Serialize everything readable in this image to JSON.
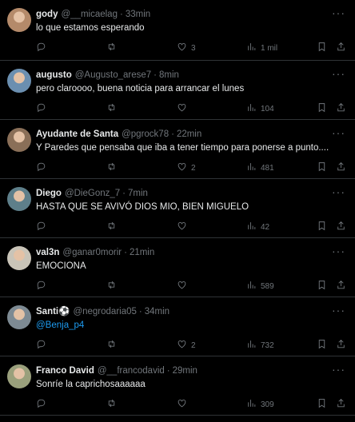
{
  "tweets": [
    {
      "name": "gody",
      "handle": "@__micaelag",
      "sep": "·",
      "time": "33min",
      "text": "lo que estamos esperando",
      "likes": "3",
      "views": "1 mil",
      "avatar": "#b48a6a"
    },
    {
      "name": "augusto",
      "handle": "@Augusto_arese7",
      "sep": "·",
      "time": "8min",
      "text": "pero claroooo, buena noticia para arrancar el lunes",
      "likes": "",
      "views": "104",
      "avatar": "#6b8fb0"
    },
    {
      "name": "Ayudante de Santa",
      "handle": "@pgrock78",
      "sep": "·",
      "time": "22min",
      "text": "Y Paredes que pensaba que iba a tener tiempo para ponerse a punto....",
      "likes": "2",
      "views": "481",
      "avatar": "#8a6f58"
    },
    {
      "name": "Diego",
      "handle": "@DieGonz_7",
      "sep": "·",
      "time": "7min",
      "text": "HASTA QUE SE AVIVÓ DIOS MIO, BIEN MIGUELO",
      "likes": "",
      "views": "42",
      "avatar": "#5e7f8a"
    },
    {
      "name": "val3n",
      "handle": "@ganar0morir",
      "sep": "·",
      "time": "21min",
      "text": "EMOCIONA",
      "likes": "",
      "views": "589",
      "avatar": "#c9c4b8"
    },
    {
      "name": "Santi⚽",
      "handle": "@negrodaria05",
      "sep": "·",
      "time": "34min",
      "text": "@Benja_p4",
      "likes": "2",
      "views": "732",
      "avatar": "#7d8a93",
      "mention": true
    },
    {
      "name": "Franco David",
      "handle": "@__francodavid",
      "sep": "·",
      "time": "29min",
      "text": "Sonríe la caprichosaaaaaa",
      "likes": "",
      "views": "309",
      "avatar": "#9aa07c"
    }
  ]
}
